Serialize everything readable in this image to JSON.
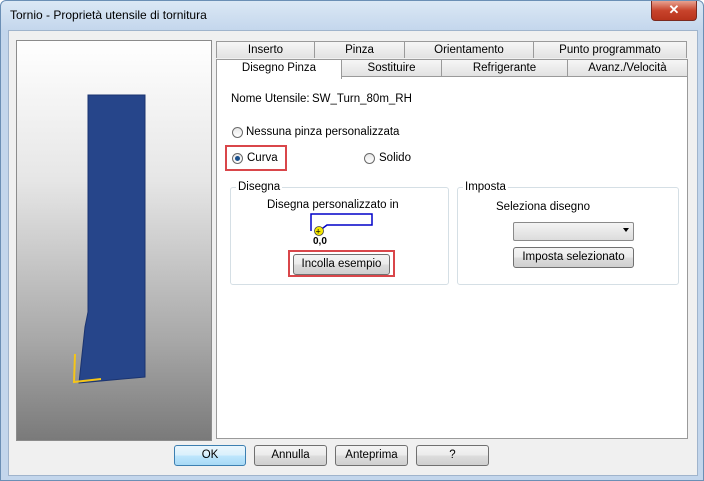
{
  "window": {
    "title": "Tornio - Proprietà utensile di tornitura"
  },
  "tabs_back": [
    "Inserto",
    "Pinza",
    "Orientamento",
    "Punto programmato"
  ],
  "tabs_front": [
    "Disegno Pinza",
    "Sostituire",
    "Refrigerante",
    "Avanz./Velocità"
  ],
  "active_tab": "Disegno Pinza",
  "tool_name": {
    "label": "Nome Utensile:",
    "value": "SW_Turn_80m_RH"
  },
  "holder_options": {
    "none_label": "Nessuna pinza personalizzata",
    "curve_label": "Curva",
    "solid_label": "Solido",
    "selected": "Curva"
  },
  "draw_group": {
    "title": "Disegna",
    "caption": "Disegna personalizzato in",
    "origin_label": "0,0",
    "paste_button": "Incolla esempio"
  },
  "set_group": {
    "title": "Imposta",
    "select_label": "Seleziona disegno",
    "combo_value": "",
    "set_button": "Imposta selezionato"
  },
  "footer": {
    "ok": "OK",
    "cancel": "Annulla",
    "preview": "Anteprima",
    "help": "?"
  },
  "colors": {
    "tool_body": "#26458a",
    "highlight": "#d9464a",
    "insert": "#f5c518"
  }
}
